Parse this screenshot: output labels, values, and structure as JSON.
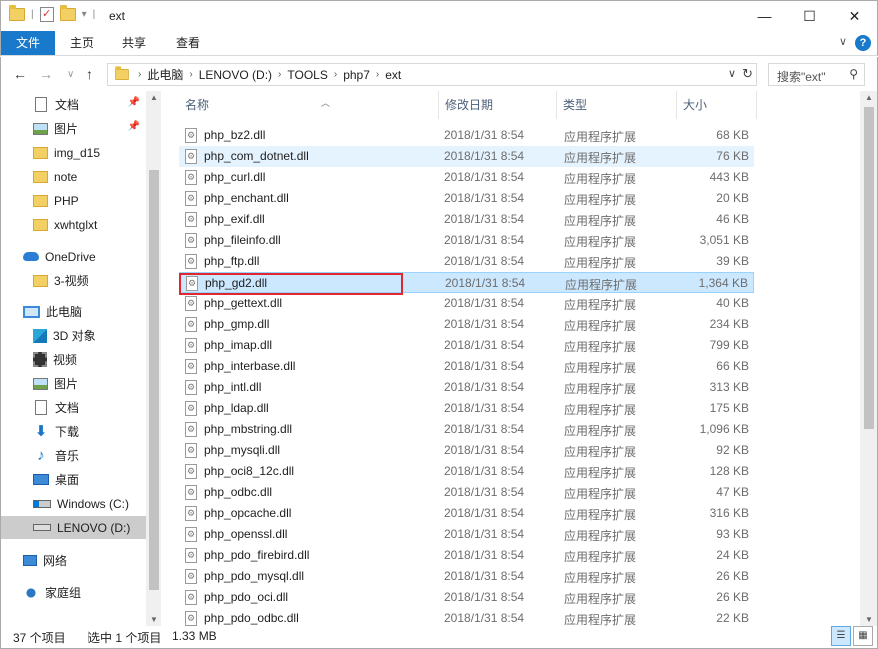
{
  "window": {
    "title": "ext",
    "minimize": "—",
    "maximize": "☐",
    "close": "✕"
  },
  "ribbon": {
    "file": "文件",
    "home": "主页",
    "share": "共享",
    "view": "查看"
  },
  "address": {
    "crumbs": [
      "此电脑",
      "LENOVO (D:)",
      "TOOLS",
      "php7",
      "ext"
    ],
    "search_placeholder": "搜索\"ext\""
  },
  "nav": {
    "items": [
      {
        "label": "文档",
        "icon": "document-icon",
        "pinned": true
      },
      {
        "label": "图片",
        "icon": "pictures-icon",
        "pinned": true
      },
      {
        "label": "img_d15",
        "icon": "folder-icon"
      },
      {
        "label": "note",
        "icon": "folder-icon"
      },
      {
        "label": "PHP",
        "icon": "folder-icon"
      },
      {
        "label": "xwhtglxt",
        "icon": "folder-icon"
      },
      {
        "label": "OneDrive",
        "icon": "onedrive-icon"
      },
      {
        "label": "3-视频",
        "icon": "folder-icon"
      },
      {
        "label": "此电脑",
        "icon": "this-pc-icon"
      },
      {
        "label": "3D 对象",
        "icon": "3d-objects-icon"
      },
      {
        "label": "视频",
        "icon": "videos-icon"
      },
      {
        "label": "图片",
        "icon": "pictures-icon"
      },
      {
        "label": "文档",
        "icon": "document-icon"
      },
      {
        "label": "下载",
        "icon": "downloads-icon"
      },
      {
        "label": "音乐",
        "icon": "music-icon"
      },
      {
        "label": "桌面",
        "icon": "desktop-icon"
      },
      {
        "label": "Windows (C:)",
        "icon": "windows-drive-icon"
      },
      {
        "label": "LENOVO (D:)",
        "icon": "drive-icon",
        "selected": true
      },
      {
        "label": "网络",
        "icon": "network-icon"
      },
      {
        "label": "家庭组",
        "icon": "homegroup-icon"
      }
    ]
  },
  "columns": {
    "name": "名称",
    "date": "修改日期",
    "type": "类型",
    "size": "大小"
  },
  "files": [
    {
      "name": "php_bz2.dll",
      "date": "2018/1/31 8:54",
      "type": "应用程序扩展",
      "size": "68 KB"
    },
    {
      "name": "php_com_dotnet.dll",
      "date": "2018/1/31 8:54",
      "type": "应用程序扩展",
      "size": "76 KB",
      "hover": true
    },
    {
      "name": "php_curl.dll",
      "date": "2018/1/31 8:54",
      "type": "应用程序扩展",
      "size": "443 KB"
    },
    {
      "name": "php_enchant.dll",
      "date": "2018/1/31 8:54",
      "type": "应用程序扩展",
      "size": "20 KB"
    },
    {
      "name": "php_exif.dll",
      "date": "2018/1/31 8:54",
      "type": "应用程序扩展",
      "size": "46 KB"
    },
    {
      "name": "php_fileinfo.dll",
      "date": "2018/1/31 8:54",
      "type": "应用程序扩展",
      "size": "3,051 KB"
    },
    {
      "name": "php_ftp.dll",
      "date": "2018/1/31 8:54",
      "type": "应用程序扩展",
      "size": "39 KB"
    },
    {
      "name": "php_gd2.dll",
      "date": "2018/1/31 8:54",
      "type": "应用程序扩展",
      "size": "1,364 KB",
      "selected": true
    },
    {
      "name": "php_gettext.dll",
      "date": "2018/1/31 8:54",
      "type": "应用程序扩展",
      "size": "40 KB"
    },
    {
      "name": "php_gmp.dll",
      "date": "2018/1/31 8:54",
      "type": "应用程序扩展",
      "size": "234 KB"
    },
    {
      "name": "php_imap.dll",
      "date": "2018/1/31 8:54",
      "type": "应用程序扩展",
      "size": "799 KB"
    },
    {
      "name": "php_interbase.dll",
      "date": "2018/1/31 8:54",
      "type": "应用程序扩展",
      "size": "66 KB"
    },
    {
      "name": "php_intl.dll",
      "date": "2018/1/31 8:54",
      "type": "应用程序扩展",
      "size": "313 KB"
    },
    {
      "name": "php_ldap.dll",
      "date": "2018/1/31 8:54",
      "type": "应用程序扩展",
      "size": "175 KB"
    },
    {
      "name": "php_mbstring.dll",
      "date": "2018/1/31 8:54",
      "type": "应用程序扩展",
      "size": "1,096 KB"
    },
    {
      "name": "php_mysqli.dll",
      "date": "2018/1/31 8:54",
      "type": "应用程序扩展",
      "size": "92 KB"
    },
    {
      "name": "php_oci8_12c.dll",
      "date": "2018/1/31 8:54",
      "type": "应用程序扩展",
      "size": "128 KB"
    },
    {
      "name": "php_odbc.dll",
      "date": "2018/1/31 8:54",
      "type": "应用程序扩展",
      "size": "47 KB"
    },
    {
      "name": "php_opcache.dll",
      "date": "2018/1/31 8:54",
      "type": "应用程序扩展",
      "size": "316 KB"
    },
    {
      "name": "php_openssl.dll",
      "date": "2018/1/31 8:54",
      "type": "应用程序扩展",
      "size": "93 KB"
    },
    {
      "name": "php_pdo_firebird.dll",
      "date": "2018/1/31 8:54",
      "type": "应用程序扩展",
      "size": "24 KB"
    },
    {
      "name": "php_pdo_mysql.dll",
      "date": "2018/1/31 8:54",
      "type": "应用程序扩展",
      "size": "26 KB"
    },
    {
      "name": "php_pdo_oci.dll",
      "date": "2018/1/31 8:54",
      "type": "应用程序扩展",
      "size": "26 KB"
    },
    {
      "name": "php_pdo_odbc.dll",
      "date": "2018/1/31 8:54",
      "type": "应用程序扩展",
      "size": "22 KB"
    }
  ],
  "status": {
    "count": "37 个项目",
    "selection": "选中 1 个项目",
    "size": "1.33 MB"
  },
  "colors": {
    "accent": "#1979ca",
    "selected_row": "#cce8ff",
    "hover_row": "#e5f3ff",
    "highlight_box": "#e0262e"
  }
}
